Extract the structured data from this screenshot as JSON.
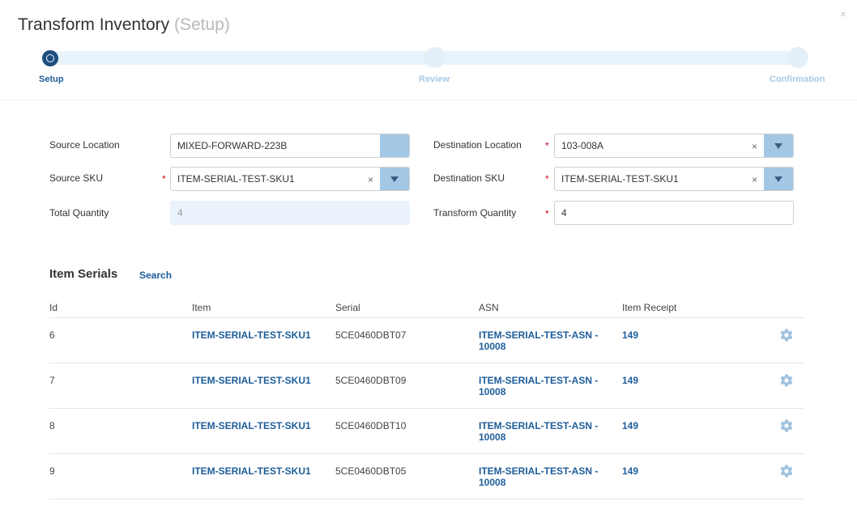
{
  "dialog": {
    "title": "Transform Inventory",
    "subtitle": "(Setup)",
    "close_glyph": "×"
  },
  "stepper": {
    "steps": [
      {
        "label": "Setup",
        "state": "active"
      },
      {
        "label": "Review",
        "state": "inactive"
      },
      {
        "label": "Confirmation",
        "state": "inactive"
      }
    ]
  },
  "form": {
    "source_location": {
      "label": "Source Location",
      "value": "MIXED-FORWARD-223B"
    },
    "source_sku": {
      "label": "Source SKU",
      "value": "ITEM-SERIAL-TEST-SKU1",
      "required": "*"
    },
    "total_quantity": {
      "label": "Total Quantity",
      "value": "4"
    },
    "destination_location": {
      "label": "Destination Location",
      "value": "103-008A",
      "required": "*"
    },
    "destination_sku": {
      "label": "Destination SKU",
      "value": "ITEM-SERIAL-TEST-SKU1",
      "required": "*"
    },
    "transform_quantity": {
      "label": "Transform Quantity",
      "value": "4",
      "required": "*"
    },
    "clear_glyph": "×"
  },
  "serials": {
    "title": "Item Serials",
    "search_label": "Search",
    "columns": [
      "Id",
      "Item",
      "Serial",
      "ASN",
      "Item Receipt"
    ],
    "rows": [
      {
        "id": "6",
        "item": "ITEM-SERIAL-TEST-SKU1",
        "serial": "5CE0460DBT07",
        "asn_line1": "ITEM-SERIAL-TEST-ASN -",
        "asn_line2": "10008",
        "receipt": "149"
      },
      {
        "id": "7",
        "item": "ITEM-SERIAL-TEST-SKU1",
        "serial": "5CE0460DBT09",
        "asn_line1": "ITEM-SERIAL-TEST-ASN -",
        "asn_line2": "10008",
        "receipt": "149"
      },
      {
        "id": "8",
        "item": "ITEM-SERIAL-TEST-SKU1",
        "serial": "5CE0460DBT10",
        "asn_line1": "ITEM-SERIAL-TEST-ASN -",
        "asn_line2": "10008",
        "receipt": "149"
      },
      {
        "id": "9",
        "item": "ITEM-SERIAL-TEST-SKU1",
        "serial": "5CE0460DBT05",
        "asn_line1": "ITEM-SERIAL-TEST-ASN -",
        "asn_line2": "10008",
        "receipt": "149"
      }
    ]
  },
  "colors": {
    "accent": "#1d5d99",
    "step_active": "#1d4e7f",
    "track": "#e8f3fb",
    "dropdown_button": "#a3c8e6",
    "required": "#d0021b",
    "gear": "#9fc1df"
  },
  "icons": {
    "close": "close-icon",
    "clear": "clear-icon",
    "dropdown": "chevron-down-icon",
    "row_action": "gear-icon"
  }
}
